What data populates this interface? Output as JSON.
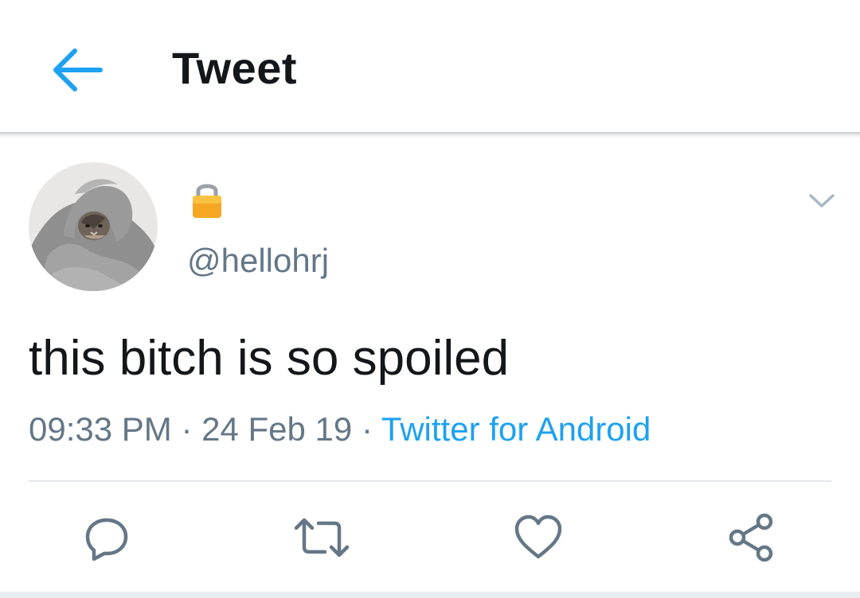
{
  "app_bar": {
    "title": "Tweet",
    "back_icon": "arrow-left-icon",
    "accent_color": "#1da1f2"
  },
  "tweet": {
    "avatar_icon": "cat-in-blanket-avatar",
    "lock_icon": "lock-icon",
    "handle": "@hellohrj",
    "menu_icon": "chevron-down-icon",
    "text": "this bitch is so spoiled",
    "time": "09:33 PM",
    "separator": "·",
    "date": "24 Feb 19",
    "source": "Twitter for Android"
  },
  "actions": {
    "reply_icon": "reply-icon",
    "retweet_icon": "retweet-icon",
    "like_icon": "heart-icon",
    "share_icon": "share-icon",
    "icon_color": "#657786"
  }
}
